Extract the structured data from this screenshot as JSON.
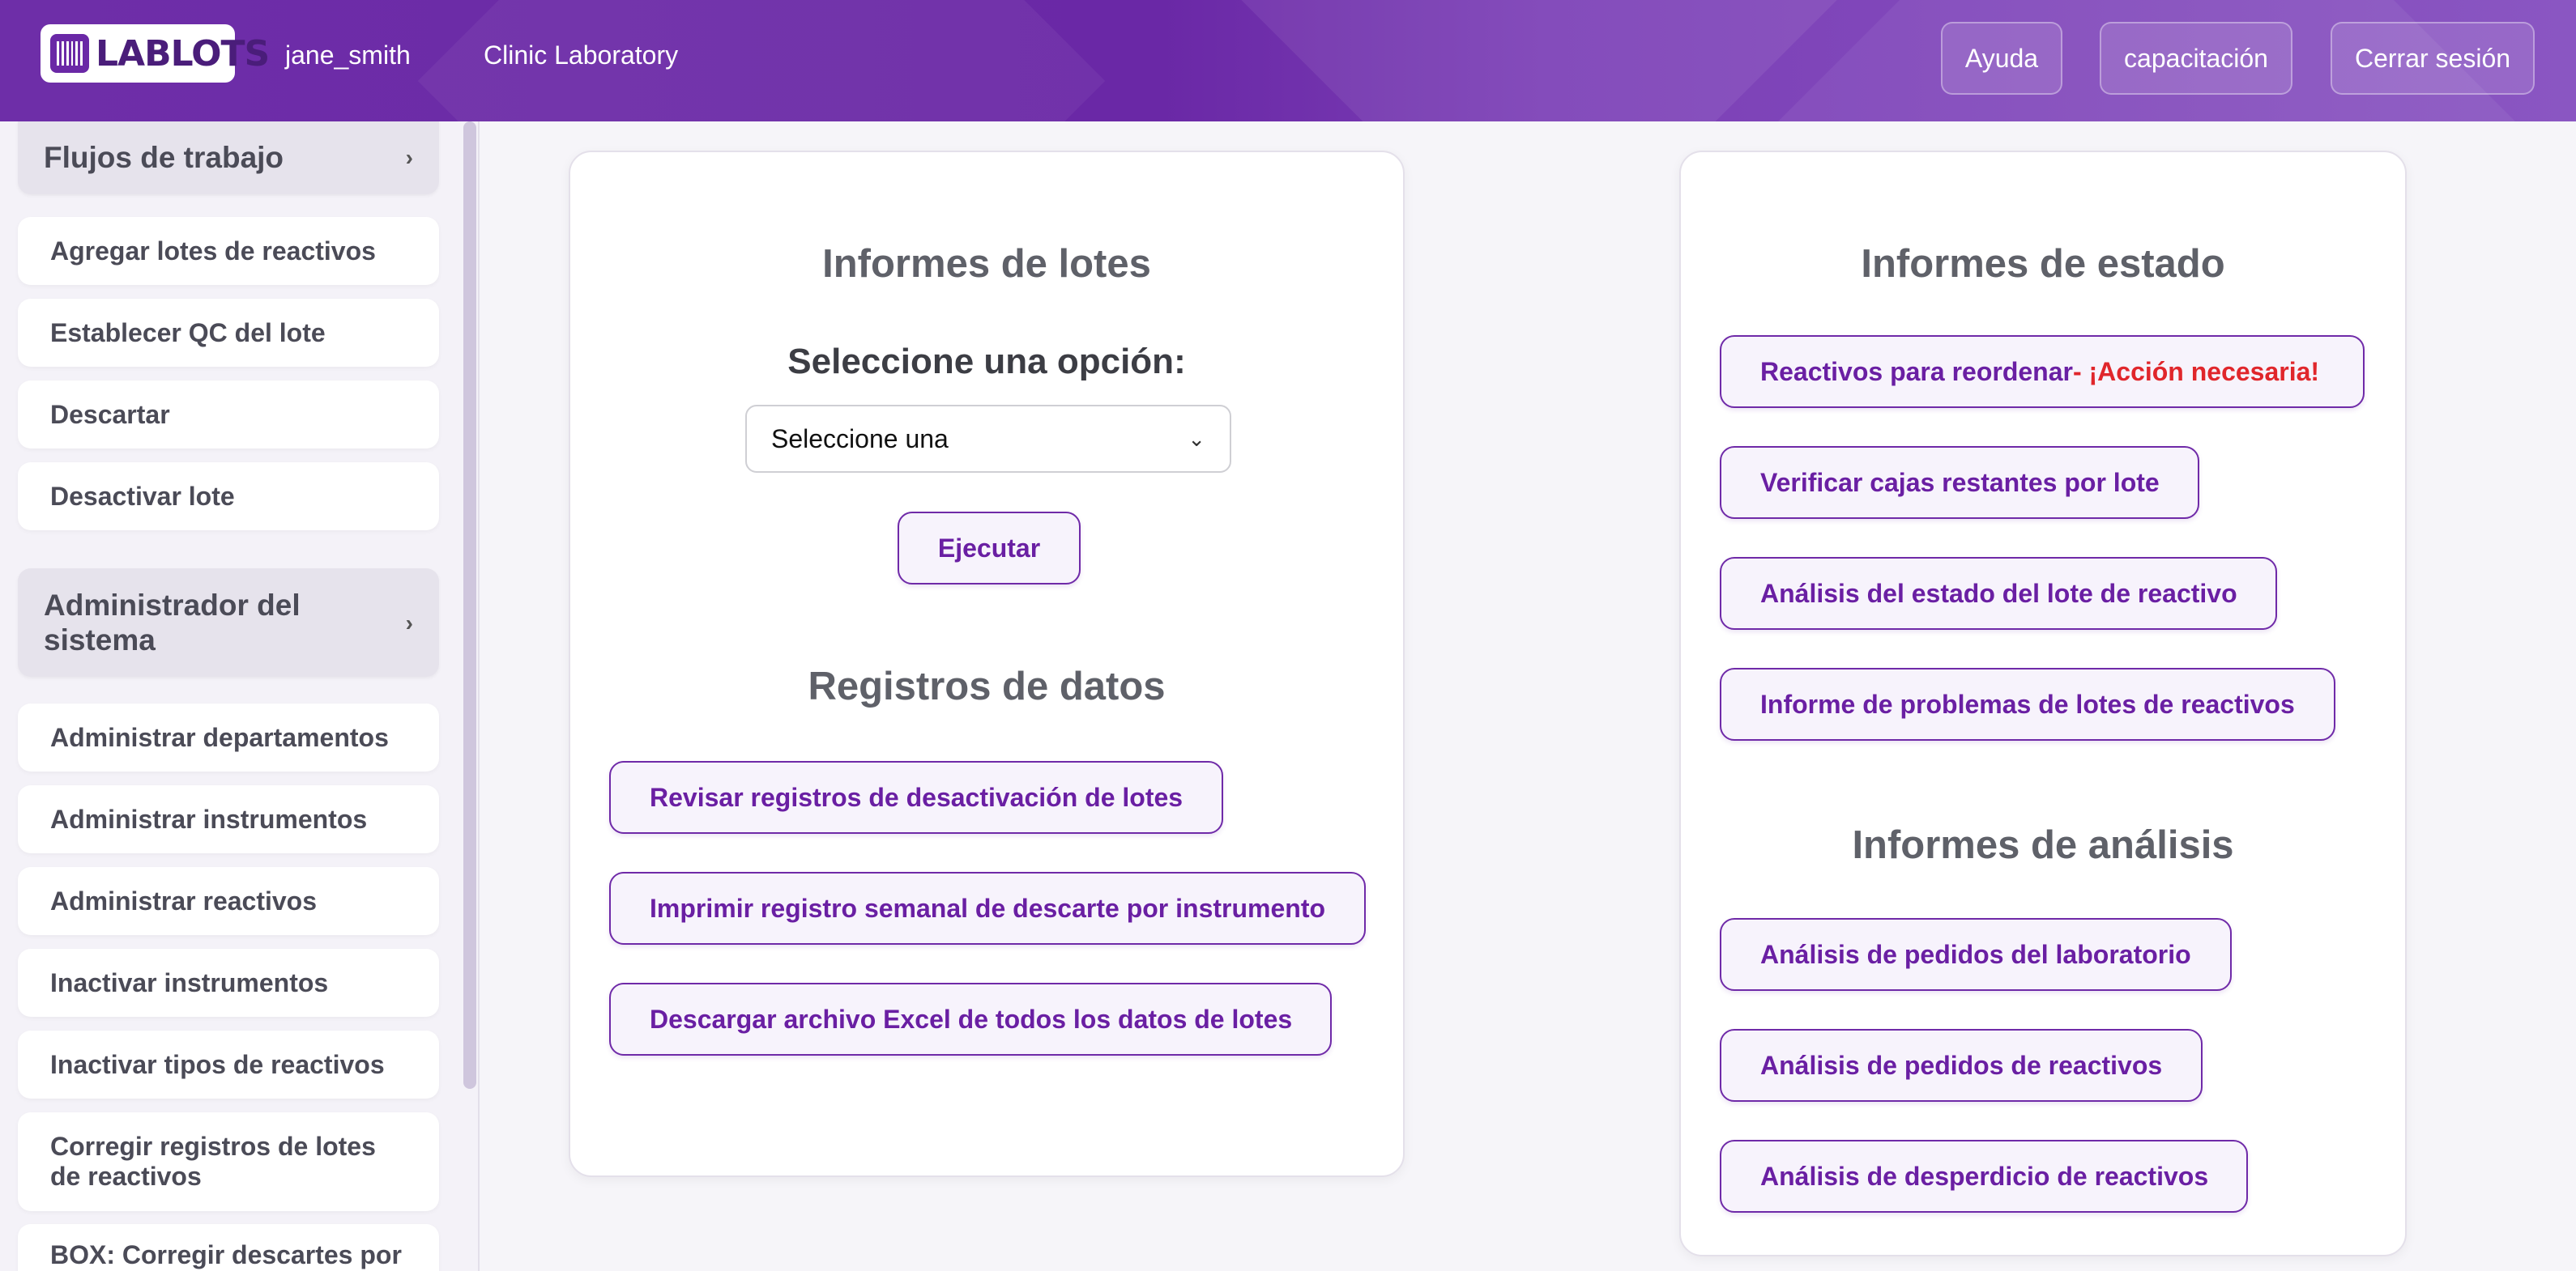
{
  "header": {
    "brand": "LABLOTS",
    "username": "jane_smith",
    "lab_name": "Clinic Laboratory",
    "help_label": "Ayuda",
    "training_label": "capacitación",
    "logout_label": "Cerrar sesión"
  },
  "sidebar": {
    "workflows_title": "Flujos de trabajo",
    "workflow_items": [
      "Agregar lotes de reactivos",
      "Establecer QC del lote",
      "Descartar",
      "Desactivar lote"
    ],
    "admin_title": "Administrador del sistema",
    "admin_items": [
      "Administrar departamentos",
      "Administrar instrumentos",
      "Administrar reactivos",
      "Inactivar instrumentos",
      "Inactivar tipos de reactivos",
      "Corregir registros de lotes de reactivos",
      "BOX: Corregir descartes por"
    ]
  },
  "lot_reports": {
    "title": "Informes de lotes",
    "prompt": "Seleccione una opción:",
    "select_value": "Seleccione una",
    "run_label": "Ejecutar"
  },
  "data_logs": {
    "title": "Registros de datos",
    "buttons": [
      "Revisar registros de desactivación de lotes",
      "Imprimir registro semanal de descarte por instrumento",
      "Descargar archivo Excel de todos los datos de lotes"
    ]
  },
  "status_reports": {
    "title": "Informes de estado",
    "reorder_label": "Reactivos para reordenar",
    "reorder_alert": " - ¡Acción necesaria!",
    "buttons": [
      "Verificar cajas restantes por lote",
      "Análisis del estado del lote de reactivo",
      "Informe de problemas de lotes de reactivos"
    ]
  },
  "analysis_reports": {
    "title": "Informes de análisis",
    "buttons": [
      "Análisis de pedidos del laboratorio",
      "Análisis de pedidos de reactivos",
      "Análisis de desperdicio de reactivos"
    ]
  },
  "colors": {
    "brand_purple": "#6a28a6",
    "alert_red": "#e0262b"
  }
}
